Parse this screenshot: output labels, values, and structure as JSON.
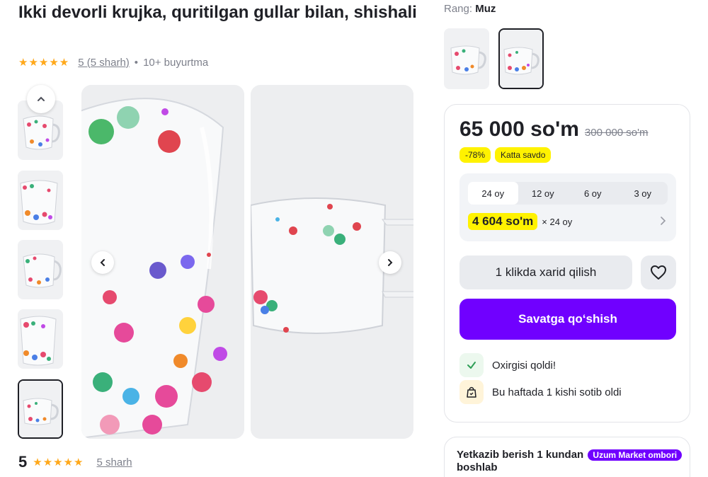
{
  "product": {
    "title": "Ikki devorli krujka, quritilgan gullar bilan, shishali",
    "stars": "★★★★★",
    "rating_link": "5 (5 sharh)",
    "dot": "•",
    "orders": "10+ buyurtma",
    "score": "5",
    "score_reviews_link": "5 sharh"
  },
  "gallery": {
    "up_icon": "chevron-up-icon",
    "prev_icon": "chevron-left-icon",
    "next_icon": "chevron-right-icon",
    "active_thumb_index": 4
  },
  "variant": {
    "label": "Rang:",
    "value": "Muz",
    "active_index": 1
  },
  "buy": {
    "price": "65 000 so'm",
    "old_price": "300 000 so'm",
    "discount_badge": "-78%",
    "sale_badge": "Katta savdo",
    "installment_tabs": [
      "24 oy",
      "12 oy",
      "6 oy",
      "3 oy"
    ],
    "installment_active_index": 0,
    "installment_price": "4 604 so'm",
    "installment_multiplier": "× 24 oy",
    "one_click_label": "1 klikda xarid qilish",
    "add_to_cart_label": "Savatga qo‘shish",
    "fav_icon": "heart-icon",
    "info": [
      {
        "icon": "check-icon",
        "text": "Oxirgisi qoldi!",
        "bg": "#ecf8ee"
      },
      {
        "icon": "shopping-bag-icon",
        "text": "Bu haftada 1 kishi sotib oldi",
        "bg": "#fff4d9"
      }
    ]
  },
  "delivery": {
    "text": "Yetkazib berish 1 kundan",
    "badge": "Uzum Market ombori",
    "text2": "boshlab"
  },
  "colors": {
    "accent": "#7000ff",
    "highlight": "#fff200",
    "star": "#ffa81a",
    "text": "#1f2026",
    "muted": "#7e818c"
  }
}
